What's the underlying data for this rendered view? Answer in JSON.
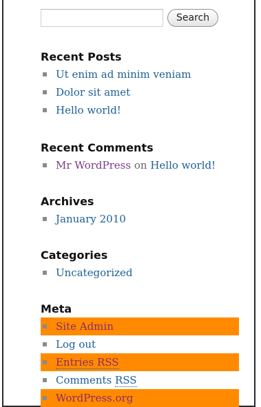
{
  "search": {
    "input_value": "",
    "button_label": "Search"
  },
  "recent_posts": {
    "title": "Recent Posts",
    "items": [
      {
        "label": "Ut enim ad minim veniam"
      },
      {
        "label": "Dolor sit amet"
      },
      {
        "label": "Hello world!"
      }
    ]
  },
  "recent_comments": {
    "title": "Recent Comments",
    "items": [
      {
        "author": "Mr WordPress",
        "connector": "on",
        "post": "Hello world!"
      }
    ]
  },
  "archives": {
    "title": "Archives",
    "items": [
      {
        "label": "January 2010"
      }
    ]
  },
  "categories": {
    "title": "Categories",
    "items": [
      {
        "label": "Uncategorized"
      }
    ]
  },
  "meta": {
    "title": "Meta",
    "items": [
      {
        "label": "Site Admin",
        "highlighted": true
      },
      {
        "label": "Log out",
        "highlighted": false
      },
      {
        "label": "Entries RSS",
        "highlighted": true
      },
      {
        "label_prefix": "Comments ",
        "label_abbr": "RSS",
        "highlighted": false
      },
      {
        "label": "WordPress.org",
        "highlighted": true
      }
    ]
  },
  "colors": {
    "link": "#1b5e96",
    "visited_link": "#7b3a8a",
    "highlight": "#ff8a00"
  }
}
